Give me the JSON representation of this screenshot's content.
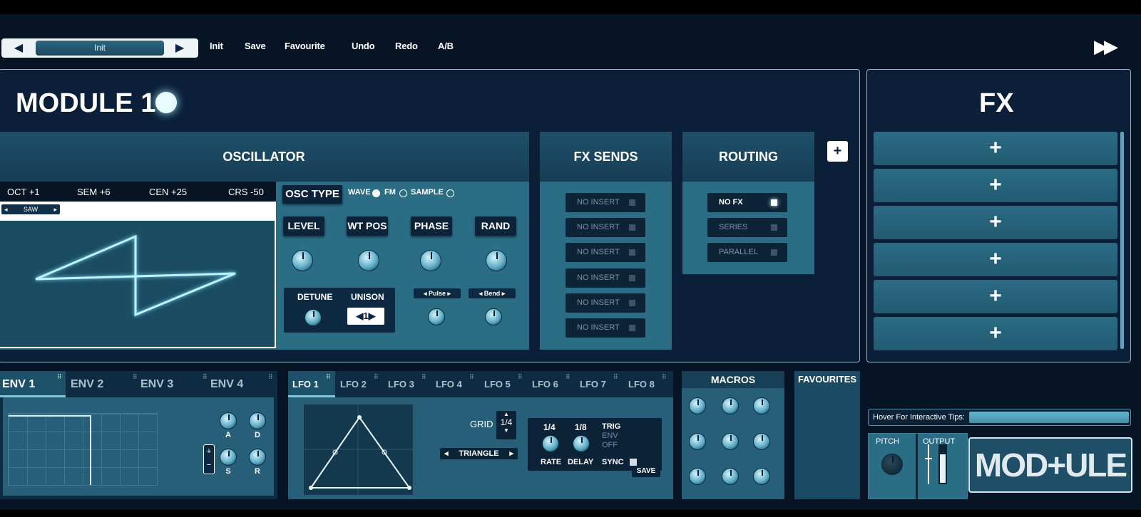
{
  "toolbar": {
    "preset_prev": "◀",
    "preset_name": "Init",
    "preset_next": "▶",
    "init": "Init",
    "save": "Save",
    "favourite": "Favourite",
    "undo": "Undo",
    "redo": "Redo",
    "ab": "A/B",
    "forward": "▶▶"
  },
  "module": {
    "title": "MODULE 1"
  },
  "oscillator": {
    "title": "OSCILLATOR",
    "oct": "OCT +1",
    "sem": "SEM +6",
    "cen": "CEN +25",
    "crs": "CRS -50",
    "wave_select": "SAW",
    "osc_type": "OSC TYPE",
    "types": [
      "WAVE",
      "FM",
      "SAMPLE"
    ],
    "selected_type": "WAVE",
    "level": "LEVEL",
    "wt_pos": "WT POS",
    "phase": "PHASE",
    "rand": "RAND",
    "detune": "DETUNE",
    "unison": "UNISON",
    "unison_value": "1",
    "pulse": "Pulse",
    "bend": "Bend"
  },
  "fx_sends": {
    "title": "FX SENDS",
    "slots": [
      "NO INSERT",
      "NO INSERT",
      "NO INSERT",
      "NO INSERT",
      "NO INSERT",
      "NO INSERT"
    ]
  },
  "routing": {
    "title": "ROUTING",
    "options": [
      "NO FX",
      "SERIES",
      "PARALLEL"
    ],
    "selected": "NO FX",
    "add": "+"
  },
  "fx": {
    "title": "FX",
    "slots": [
      "+",
      "+",
      "+",
      "+",
      "+",
      "+"
    ]
  },
  "env": {
    "tabs": [
      "ENV 1",
      "ENV 2",
      "ENV 3",
      "ENV 4"
    ],
    "active": "ENV 1",
    "a": "A",
    "d": "D",
    "s": "S",
    "r": "R",
    "plus": "+",
    "minus": "−"
  },
  "lfo": {
    "tabs": [
      "LFO 1",
      "LFO 2",
      "LFO 3",
      "LFO 4",
      "LFO 5",
      "LFO 6",
      "LFO 7",
      "LFO 8"
    ],
    "active": "LFO 1",
    "grid_label": "GRID",
    "grid_value": "1/4",
    "shape": "TRIANGLE",
    "rate_value": "1/4",
    "delay_value": "1/8",
    "rate": "RATE",
    "delay": "DELAY",
    "sync": "SYNC",
    "trig": "TRIG",
    "env": "ENV",
    "off": "OFF",
    "save": "SAVE"
  },
  "macros": {
    "title": "MACROS"
  },
  "favourites": {
    "title": "FAVOURITES"
  },
  "tips": {
    "label": "Hover For Interactive Tips:"
  },
  "output": {
    "pitch": "PITCH",
    "output": "OUTPUT"
  },
  "logo": {
    "text": "MOD+ULE"
  },
  "colors": {
    "background": "#071425",
    "panel": "#1a4b63",
    "panel_light": "#2a6d85",
    "accent": "#e8fbff"
  }
}
